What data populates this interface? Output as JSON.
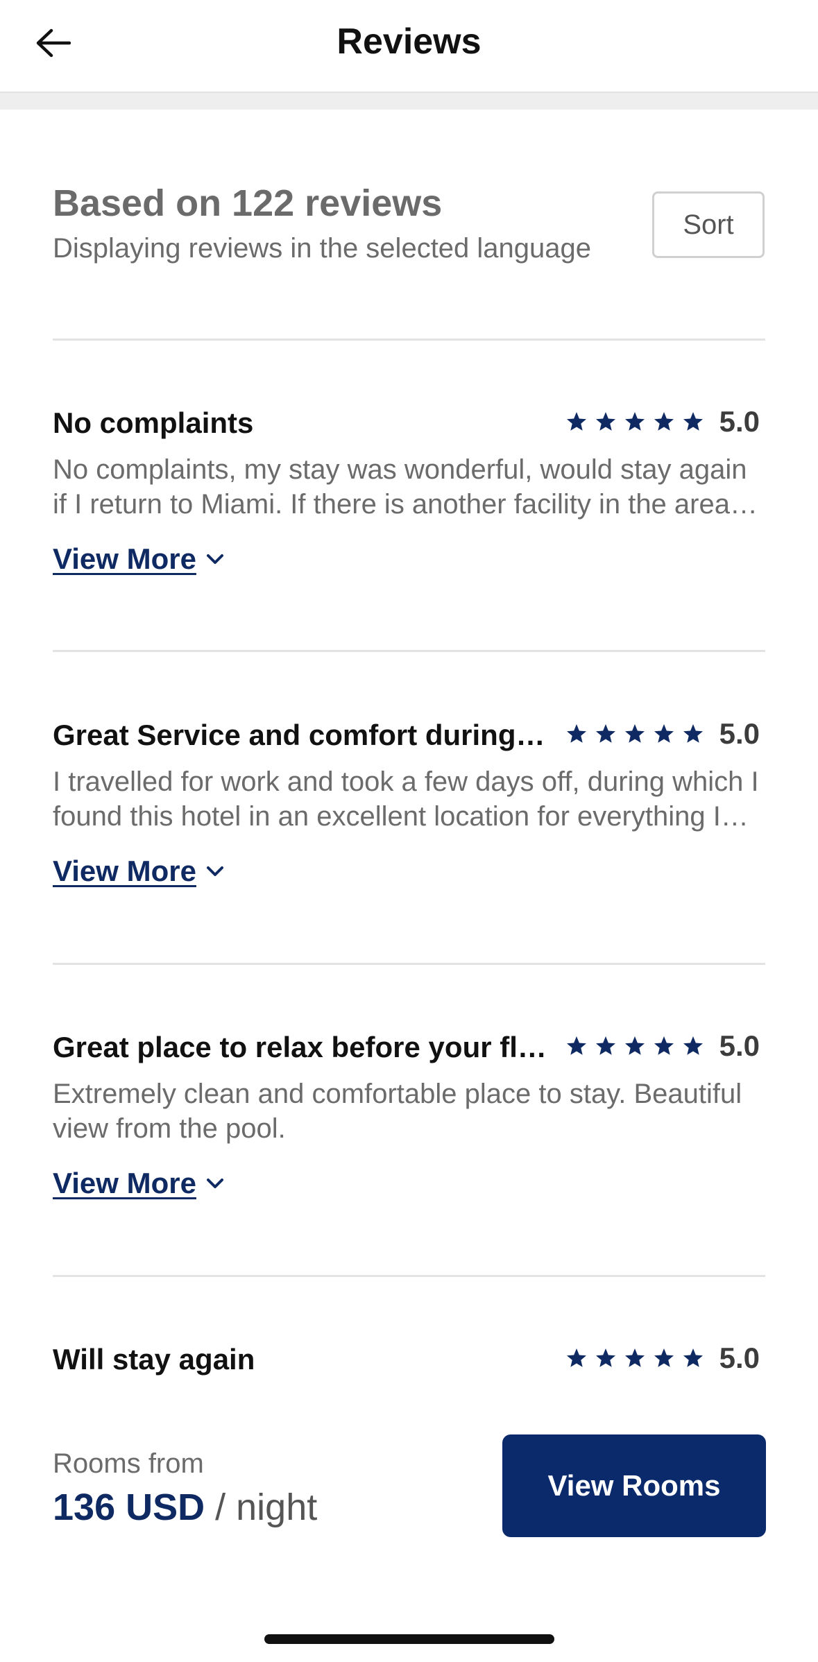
{
  "header": {
    "title": "Reviews",
    "back_icon": "arrow-left-icon"
  },
  "summary": {
    "title": "Based on 122 reviews",
    "subtitle": "Displaying reviews in the selected language",
    "sort_label": "Sort"
  },
  "reviews": [
    {
      "title": "No complaints",
      "rating": 5,
      "score": "5.0",
      "body": "No complaints, my stay was wonderful, would stay again if I return to Miami. If there is another facility in the area I would love to stay there as well.",
      "view_more": "View More"
    },
    {
      "title": "Great Service and comfort during my stay",
      "rating": 5,
      "score": "5.0",
      "body": "I travelled for work and took a few days off, during which I found this hotel in an excellent location for everything I needed during my trip.",
      "view_more": "View More"
    },
    {
      "title": "Great place to relax before your flight",
      "rating": 5,
      "score": "5.0",
      "body": "Extremely clean and comfortable place to stay. Beautiful view from the pool.",
      "view_more": "View More"
    },
    {
      "title": "Will stay again",
      "rating": 5,
      "score": "5.0"
    }
  ],
  "footer": {
    "rooms_from_label": "Rooms from",
    "price": "136 USD",
    "per_night": "/ night",
    "view_rooms_label": "View Rooms"
  },
  "colors": {
    "accent": "#0b2a6b",
    "star": "#0f2a63",
    "muted_text": "#6b6b6b"
  }
}
